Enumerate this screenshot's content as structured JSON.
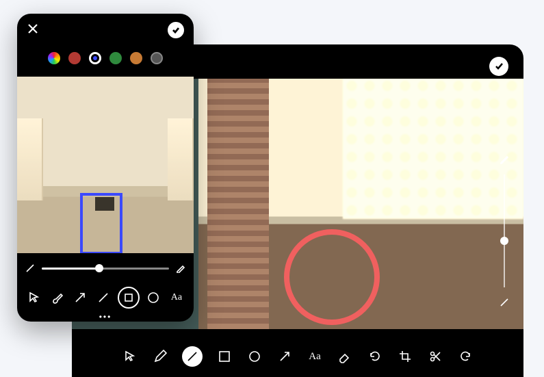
{
  "large_editor": {
    "annotation_shape": "circle",
    "annotation_color": "#f0605f",
    "thickness_slider": {
      "value": 0.55,
      "min": 0,
      "max": 1
    },
    "toolbar": [
      {
        "name": "pointer",
        "icon": "pointer-icon",
        "active": false
      },
      {
        "name": "pencil",
        "icon": "pencil-icon",
        "active": false
      },
      {
        "name": "line",
        "icon": "line-icon",
        "active": true
      },
      {
        "name": "rectangle",
        "icon": "rectangle-icon",
        "active": false
      },
      {
        "name": "circle",
        "icon": "circle-icon",
        "active": false
      },
      {
        "name": "arrow",
        "icon": "arrow-icon",
        "active": false
      },
      {
        "name": "text",
        "icon": "text-icon",
        "label": "Aa",
        "active": false
      },
      {
        "name": "eraser",
        "icon": "eraser-icon",
        "active": false
      },
      {
        "name": "rotate",
        "icon": "rotate-icon",
        "active": false
      },
      {
        "name": "crop",
        "icon": "crop-icon",
        "active": false
      },
      {
        "name": "cut",
        "icon": "scissors-icon",
        "active": false
      },
      {
        "name": "undo",
        "icon": "undo-icon",
        "active": false
      }
    ]
  },
  "small_editor": {
    "colors": [
      {
        "name": "multi",
        "hex": "conic"
      },
      {
        "name": "red",
        "hex": "#b23a33"
      },
      {
        "name": "blue",
        "hex": "#3b49ff",
        "selected": true
      },
      {
        "name": "green",
        "hex": "#2f8a3d"
      },
      {
        "name": "orange",
        "hex": "#c77a34"
      },
      {
        "name": "gray",
        "hex": "#555555"
      }
    ],
    "annotation_shape": "rectangle",
    "annotation_color": "#3b49ff",
    "stroke_slider": {
      "value": 0.45,
      "min": 0,
      "max": 1
    },
    "tools": [
      {
        "name": "pointer",
        "icon": "pointer-icon",
        "active": false
      },
      {
        "name": "brush",
        "icon": "brush-icon",
        "active": false
      },
      {
        "name": "arrow",
        "icon": "arrow-icon",
        "active": false
      },
      {
        "name": "line",
        "icon": "line-icon",
        "active": false
      },
      {
        "name": "rectangle",
        "icon": "rectangle-icon",
        "active": true
      },
      {
        "name": "circle",
        "icon": "circle-icon",
        "active": false
      },
      {
        "name": "text",
        "icon": "text-icon",
        "label": "Aa",
        "active": false
      }
    ],
    "more_label": "•••"
  }
}
